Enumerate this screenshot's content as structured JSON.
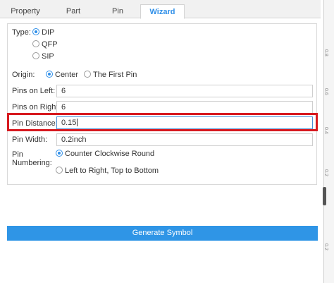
{
  "tabs": [
    {
      "label": "Property"
    },
    {
      "label": "Part"
    },
    {
      "label": "Pin"
    },
    {
      "label": "Wizard"
    }
  ],
  "type": {
    "label": "Type:",
    "options": [
      "DIP",
      "QFP",
      "SIP"
    ],
    "selected": "DIP"
  },
  "origin": {
    "label": "Origin:",
    "options": [
      "Center",
      "The First Pin"
    ],
    "selected": "Center"
  },
  "pins_left": {
    "label": "Pins on Left:",
    "value": "6"
  },
  "pins_right": {
    "label": "Pins on Right:",
    "value": "6"
  },
  "pin_distance": {
    "label": "Pin Distance:",
    "value": "0.15"
  },
  "pin_width": {
    "label": "Pin Width:",
    "value": "0.2inch"
  },
  "pin_numbering": {
    "label_line1": "Pin",
    "label_line2": "Numbering:",
    "options": [
      "Counter Clockwise Round",
      "Left to Right, Top to Bottom"
    ],
    "selected": "Counter Clockwise Round"
  },
  "generate_button": "Generate Symbol",
  "ruler": {
    "ticks": [
      "0.8",
      "0.6",
      "0.4",
      "0.2",
      "0.2"
    ]
  },
  "colors": {
    "accent": "#2f8fe8",
    "highlight": "#d7191f",
    "button": "#2f95e6"
  }
}
